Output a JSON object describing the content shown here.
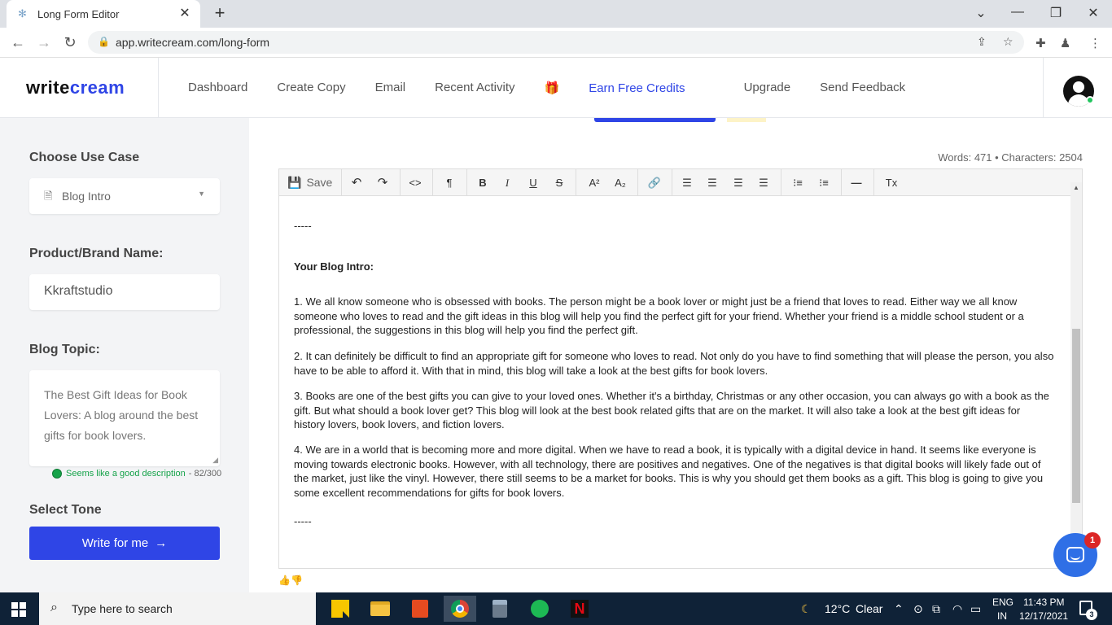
{
  "browser": {
    "tab_title": "Long Form Editor",
    "url": "app.writecream.com/long-form"
  },
  "header": {
    "logo_part1": "write",
    "logo_part2": "cream",
    "nav": {
      "dashboard": "Dashboard",
      "create_copy": "Create Copy",
      "email": "Email",
      "recent_activity": "Recent Activity",
      "earn_free_credits": "Earn Free Credits",
      "upgrade": "Upgrade",
      "send_feedback": "Send Feedback"
    },
    "accent_color": "#2f45e6"
  },
  "sidebar": {
    "use_case_label": "Choose Use Case",
    "use_case_value": "Blog Intro",
    "brand_label": "Product/Brand Name:",
    "brand_value": "Kkraftstudio",
    "topic_label": "Blog Topic:",
    "topic_value": "The Best Gift Ideas for Book Lovers: A blog around the best gifts for book lovers.",
    "desc_status": "Seems like a good description",
    "desc_count": "- 82/300",
    "tone_label": "Select Tone",
    "write_button": "Write for me"
  },
  "editor": {
    "counts": "Words: 471 • Characters: 2504",
    "toolbar": {
      "save": "Save",
      "paragraph": "¶",
      "bold": "B",
      "italic": "I",
      "underline": "U",
      "strike": "S",
      "superscript": "A²",
      "subscript": "A₂",
      "clear_format": "Tx"
    },
    "content": {
      "sep_top": "-----",
      "heading": "Your Blog Intro:",
      "p1": "1. We all know someone who is obsessed with books. The person might be a book lover or might just be a friend that loves to read. Either way we all know someone who loves to read and the gift ideas in this blog will help you find the perfect gift for your friend. Whether your friend is a middle school student or a professional, the suggestions in this blog will help you find the perfect gift.",
      "p2": "2. It can definitely be difficult to find an appropriate gift for someone who loves to read. Not only do you have to find something that will please the person, you also have to be able to afford it. With that in mind, this blog will take a look at the best gifts for book lovers.",
      "p3": "3. Books are one of the best gifts you can give to your loved ones. Whether it's a birthday, Christmas or any other occasion, you can always go with a book as the gift. But what should a book lover get? This blog will look at the best book related gifts that are on the market. It will also take a look at the best gift ideas for history lovers, book lovers, and fiction lovers.",
      "p4": "4. We are in a world that is becoming more and more digital. When we have to read a book, it is typically with a digital device in hand. It seems like everyone is moving towards electronic books. However, with all technology, there are positives and negatives. One of the negatives is that digital books will likely fade out of the market, just like the vinyl. However, there still seems to be a market for books. This is why you should get them books as a gift. This blog is going to give you some excellent recommendations for gifts for book lovers.",
      "sep_bottom": "-----"
    },
    "chat_badge": "1"
  },
  "taskbar": {
    "search_placeholder": "Type here to search",
    "weather_temp": "12°C",
    "weather_cond": "Clear",
    "lang_top": "ENG",
    "lang_bottom": "IN",
    "time": "11:43 PM",
    "date": "12/17/2021",
    "notif_count": "3"
  }
}
